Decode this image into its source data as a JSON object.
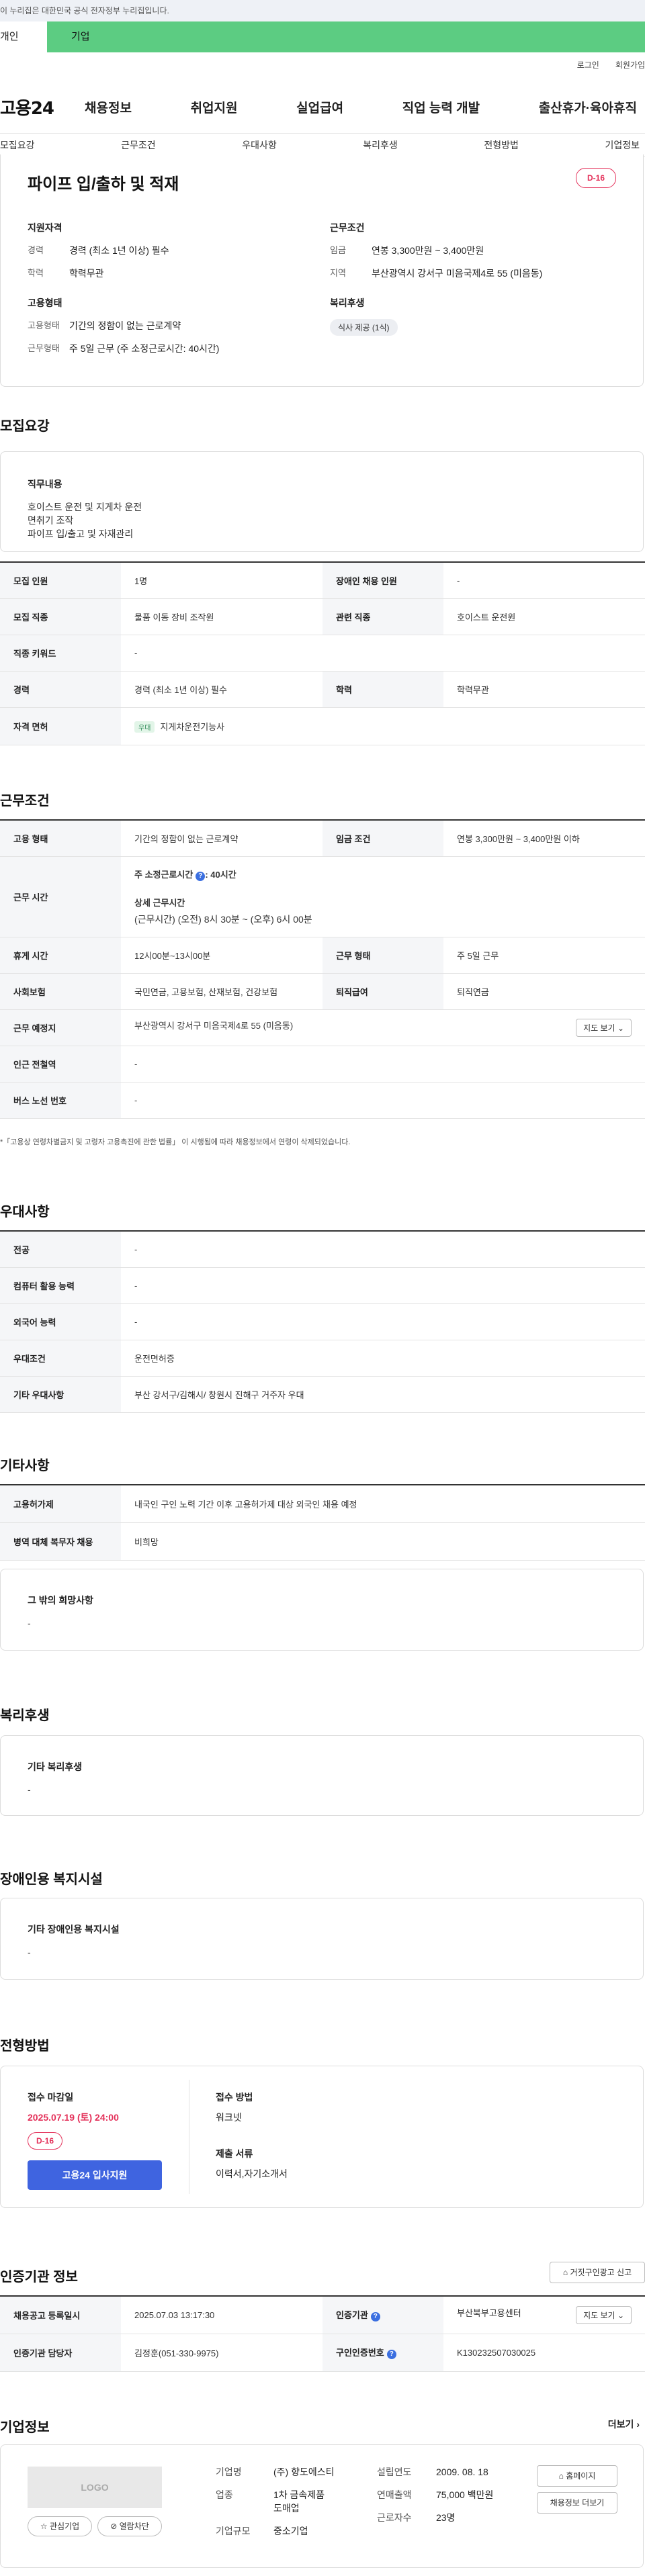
{
  "gov_banner": "이 누리집은 대한민국 공식 전자정부 누리집입니다.",
  "top_tabs": [
    "개인",
    "기업"
  ],
  "util_links": [
    "로그인",
    "회원가입"
  ],
  "logo": "고용24",
  "gnb": [
    "채용정보",
    "취업지원",
    "실업급여",
    "직업 능력 개발",
    "출산휴가·육아휴직"
  ],
  "subnav": [
    "모집요강",
    "근무조건",
    "우대사항",
    "복리후생",
    "전형방법",
    "기업정보"
  ],
  "summary": {
    "title": "파이프 입/출하 및 적재",
    "dday": "D-16",
    "qual_title": "지원자격",
    "qual": [
      {
        "k": "경력",
        "v": "경력 (최소 1년 이상) 필수"
      },
      {
        "k": "학력",
        "v": "학력무관"
      }
    ],
    "cond_title": "근무조건",
    "cond": [
      {
        "k": "임금",
        "v": "연봉 3,300만원 ~ 3,400만원"
      },
      {
        "k": "지역",
        "v": "부산광역시 강서구 미음국제4로 55 (미음동)"
      }
    ],
    "emp_title": "고용형태",
    "emp": [
      {
        "k": "고용형태",
        "v": "기간의 정함이 없는 근로계약"
      },
      {
        "k": "근무형태",
        "v": "주 5일 근무 (주 소정근로시간: 40시간)"
      }
    ],
    "welfare_title": "복리후생",
    "welfare_chip": "식사 제공 (1식)"
  },
  "recruit": {
    "title": "모집요강",
    "job_title": "직무내용",
    "job_lines": [
      "호이스트 운전 및 지게차 운전",
      "면취기 조작",
      "파이프 입/출고 및 자재관리"
    ],
    "rows": [
      {
        "k1": "모집 인원",
        "v1": "1명",
        "k2": "장애인 채용 인원",
        "v2": "-"
      },
      {
        "k1": "모집 직종",
        "v1": "물품 이동 장비 조작원",
        "k2": "관련 직종",
        "v2": "호이스트 운전원"
      },
      {
        "k1": "직종 키워드",
        "v1": "-"
      },
      {
        "k1": "경력",
        "v1": "경력 (최소 1년 이상) 필수",
        "k2": "학력",
        "v2": "학력무관"
      },
      {
        "k1": "자격 면허",
        "tag": "우대",
        "v1": "지게차운전기능사"
      }
    ]
  },
  "work": {
    "title": "근무조건",
    "emp_k": "고용 형태",
    "emp_v": "기간의 정함이 없는 근로계약",
    "wage_k": "임금 조건",
    "wage_v": "연봉 3,300만원 ~ 3,400만원 이하",
    "hours_k": "근무 시간",
    "hours_main": "주 소정근로시간",
    "hours_main_val": ": 40시간",
    "hours_detail_title": "상세 근무시간",
    "hours_detail": "(근무시간) (오전) 8시 30분 ~ (오후) 6시 00분",
    "break_k": "휴게 시간",
    "break_v": "12시00분~13시00분",
    "form_k": "근무 형태",
    "form_v": "주 5일 근무",
    "ins_k": "사회보험",
    "ins_v": "국민연금, 고용보험, 산재보험, 건강보험",
    "ret_k": "퇴직급여",
    "ret_v": "퇴직연금",
    "place_k": "근무 예정지",
    "place_v": "부산광역시 강서구 미음국제4로 55 (미음동)",
    "map_btn": "지도 보기",
    "subway_k": "인근 전철역",
    "subway_v": "-",
    "bus_k": "버스 노선 번호",
    "bus_v": "-",
    "note": "*「고용상 연령차별금지 및 고령자 고용촉진에 관한 법률」 이 시행됨에 따라 채용정보에서 연령이 삭제되었습니다."
  },
  "pref": {
    "title": "우대사항",
    "rows": [
      {
        "k": "전공",
        "v": "-"
      },
      {
        "k": "컴퓨터 활용 능력",
        "v": "-"
      },
      {
        "k": "외국어 능력",
        "v": "-"
      },
      {
        "k": "우대조건",
        "v": "운전면허증"
      },
      {
        "k": "기타 우대사항",
        "v": "부산 강서구/김해시/ 창원시 진해구  거주자 우대"
      }
    ]
  },
  "etc": {
    "title": "기타사항",
    "rows": [
      {
        "k": "고용허가제",
        "v": "내국인 구인 노력 기간 이후 고용허가제 대상 외국인 채용 예정"
      },
      {
        "k": "병역 대체 복무자 채용",
        "v": "비희망"
      }
    ],
    "other_title": "그 밖의 희망사항",
    "other_v": "-"
  },
  "welfare": {
    "title": "복리후생",
    "box_title": "기타 복리후생",
    "box_v": "-"
  },
  "disab": {
    "title": "장애인용 복지시설",
    "box_title": "기타 장애인용 복지시설",
    "box_v": "-"
  },
  "process": {
    "title": "전형방법",
    "deadline_t": "접수 마감일",
    "deadline": "2025.07.19 (토) 24:00",
    "dday": "D-16",
    "apply_btn": "고용24 입사지원",
    "method_t": "접수 방법",
    "method_v": "워크넷",
    "docs_t": "제출 서류",
    "docs_v": "이력서,자기소개서"
  },
  "cert": {
    "title": "인증기관 정보",
    "report_btn": "거짓구인광고 신고",
    "reg_k": "채용공고 등록일시",
    "reg_v": "2025.07.03 13:17:30",
    "org_k": "인증기관",
    "org_v": "부산북부고용센터",
    "map_btn": "지도 보기",
    "mgr_k": "인증기관 담당자",
    "mgr_v": "김정훈(051-330-9975)",
    "num_k": "구인인증번호",
    "num_v": "K130232507030025"
  },
  "company": {
    "title": "기업정보",
    "more": "더보기",
    "logo": "LOGO",
    "fav_btn": "관심기업",
    "block_btn": "열람차단",
    "name_k": "기업명",
    "name_v": "(주) 향도에스티",
    "ind_k": "업종",
    "ind_v": "1차 금속제품 도매업",
    "size_k": "기업규모",
    "size_v": "중소기업",
    "year_k": "설립연도",
    "year_v": "2009. 08. 18",
    "sales_k": "연매출액",
    "sales_v": "75,000 백만원",
    "emp_k": "근로자수",
    "emp_v": "23명",
    "home_btn": "홈페이지",
    "jobs_btn": "채용정보 더보기"
  }
}
